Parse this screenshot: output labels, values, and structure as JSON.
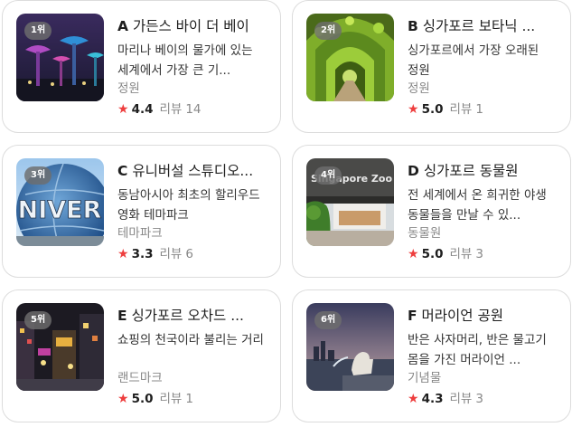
{
  "places": [
    {
      "rank": "1위",
      "letter": "A",
      "name": "가든스 바이 더 베이",
      "description": "마리나 베이의 물가에 있는 세계에서 가장 큰 기...",
      "category": "정원",
      "star_icon": "★",
      "rating": "4.4",
      "review_label": "리뷰",
      "review_count": "14",
      "thumbnail": "supertree-grove-night-photo"
    },
    {
      "rank": "2위",
      "letter": "B",
      "name": "싱가포르 보타닉 ...",
      "description": "싱가포르에서 가장 오래된 정원",
      "category": "정원",
      "star_icon": "★",
      "rating": "5.0",
      "review_label": "리뷰",
      "review_count": "1",
      "thumbnail": "green-arch-walkway-photo"
    },
    {
      "rank": "3위",
      "letter": "C",
      "name": "유니버설 스튜디오...",
      "description": "동남아시아 최초의 할리우드 영화 테마파크",
      "category": "테마파크",
      "star_icon": "★",
      "rating": "3.3",
      "review_label": "리뷰",
      "review_count": "6",
      "thumbnail": "universal-globe-photo",
      "thumbnail_text": "NIVER"
    },
    {
      "rank": "4위",
      "letter": "D",
      "name": "싱가포르 동물원",
      "description": "전 세계에서 온 희귀한 야생 동물들을 만날 수 있...",
      "category": "동물원",
      "star_icon": "★",
      "rating": "5.0",
      "review_label": "리뷰",
      "review_count": "3",
      "thumbnail": "singapore-zoo-entrance-photo",
      "thumbnail_text": "Singapore Zoo"
    },
    {
      "rank": "5위",
      "letter": "E",
      "name": "싱가포르 오차드 ...",
      "description": "쇼핑의 천국이라 불리는 거리",
      "category": "랜드마크",
      "star_icon": "★",
      "rating": "5.0",
      "review_label": "리뷰",
      "review_count": "1",
      "thumbnail": "orchard-road-night-photo"
    },
    {
      "rank": "6위",
      "letter": "F",
      "name": "머라이언 공원",
      "description": "반은 사자머리, 반은 물고기 몸을 가진 머라이언 ...",
      "category": "기념물",
      "star_icon": "★",
      "rating": "4.3",
      "review_label": "리뷰",
      "review_count": "3",
      "thumbnail": "merlion-sunset-photo"
    }
  ],
  "colors": {
    "star": "#ee3e3e",
    "card_border": "#dcdcdc",
    "rank_badge_bg": "#6e6e6e"
  }
}
